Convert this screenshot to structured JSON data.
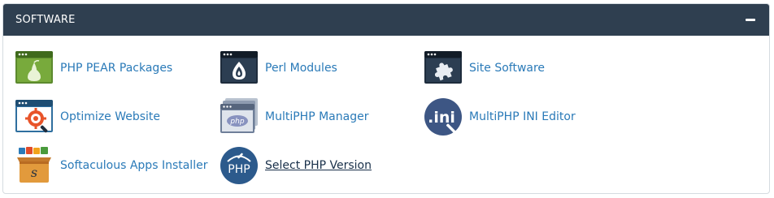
{
  "panel": {
    "title": "SOFTWARE",
    "collapse_icon": "minus-icon"
  },
  "items": [
    {
      "label": "PHP PEAR Packages",
      "icon": "pear-icon"
    },
    {
      "label": "Perl Modules",
      "icon": "perl-onion-icon"
    },
    {
      "label": "Site Software",
      "icon": "puzzle-icon"
    },
    {
      "label": "Optimize Website",
      "icon": "optimize-gear-icon"
    },
    {
      "label": "MultiPHP Manager",
      "icon": "php-windows-icon"
    },
    {
      "label": "MultiPHP INI Editor",
      "icon": "ini-editor-icon"
    },
    {
      "label": "Softaculous Apps Installer",
      "icon": "softaculous-box-icon"
    },
    {
      "label": "Select PHP Version",
      "icon": "php-circle-icon"
    }
  ],
  "colors": {
    "header_bg": "#2f3f50",
    "link": "#2a7ab8",
    "active_link": "#19304a"
  }
}
